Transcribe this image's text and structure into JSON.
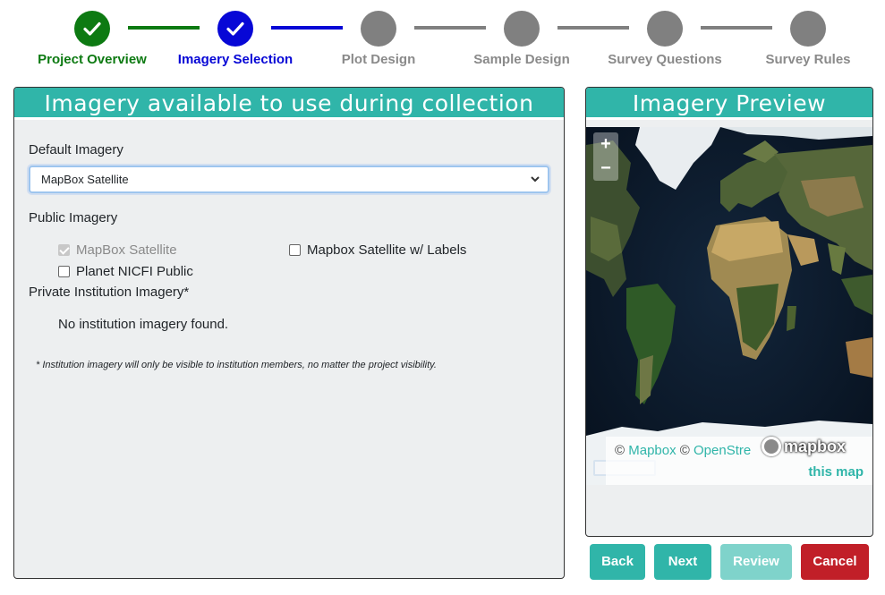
{
  "stepper": {
    "steps": [
      {
        "label": "Project Overview",
        "state": "done"
      },
      {
        "label": "Imagery Selection",
        "state": "current"
      },
      {
        "label": "Plot Design",
        "state": "pending"
      },
      {
        "label": "Sample Design",
        "state": "pending"
      },
      {
        "label": "Survey Questions",
        "state": "pending"
      },
      {
        "label": "Survey Rules",
        "state": "pending"
      }
    ]
  },
  "imagery_panel": {
    "title": "Imagery available to use during collection",
    "default_label": "Default Imagery",
    "default_value": "MapBox Satellite",
    "public_label": "Public Imagery",
    "public_options": [
      {
        "label": "MapBox Satellite",
        "checked": true,
        "disabled": true
      },
      {
        "label": "Mapbox Satellite w/ Labels",
        "checked": false,
        "disabled": false
      },
      {
        "label": "Planet NICFI Public",
        "checked": false,
        "disabled": false
      }
    ],
    "private_label": "Private Institution Imagery*",
    "no_imagery_text": "No institution imagery found.",
    "footnote": "* Institution imagery will only be visible to institution members, no matter the project visibility."
  },
  "preview_panel": {
    "title": "Imagery Preview",
    "zoom_in": "+",
    "zoom_out": "−",
    "attribution_prefix": "©",
    "attribution_mapbox": "Mapbox",
    "attribution_sep": "©",
    "attribution_osm": "OpenStre",
    "improve_text": "this map",
    "logo_text": "mapbox"
  },
  "buttons": {
    "back": "Back",
    "next": "Next",
    "review": "Review",
    "cancel": "Cancel"
  },
  "colors": {
    "teal": "#30b5a9",
    "done_green": "#0d7a12",
    "current_blue": "#0707d6",
    "pending_gray": "#808080",
    "cancel_red": "#c11f28"
  }
}
